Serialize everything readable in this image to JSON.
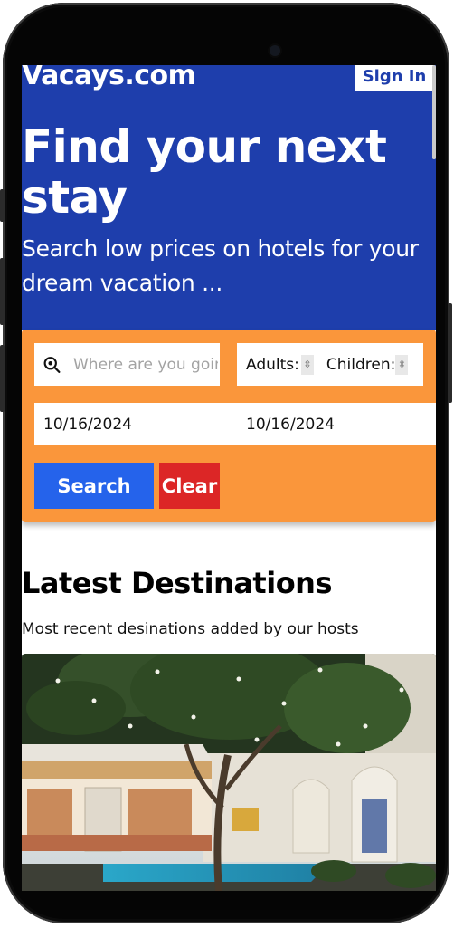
{
  "header": {
    "brand": "Vacays.com",
    "signin_label": "Sign In"
  },
  "hero": {
    "headline": "Find your next stay",
    "tagline": "Search low prices on hotels for your dream vacation ..."
  },
  "search": {
    "destination_placeholder": "Where are you going?",
    "adults_label": "Adults:",
    "children_label": "Children:",
    "check_in": "10/16/2024",
    "check_out": "10/16/2024",
    "search_label": "Search",
    "clear_label": "Clear"
  },
  "latest": {
    "title": "Latest Destinations",
    "subtitle": "Most recent desinations added by our hosts"
  },
  "colors": {
    "hero_bg": "#1e3eac",
    "panel_bg": "#fa963b",
    "search_btn": "#2563eb",
    "clear_btn": "#dc2626"
  }
}
